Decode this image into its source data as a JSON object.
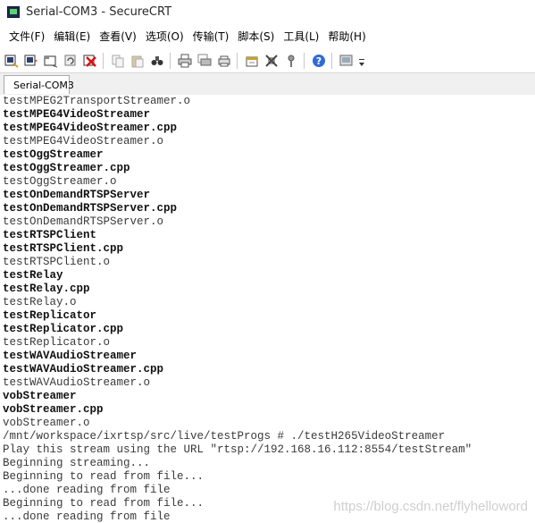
{
  "window": {
    "title": "Serial-COM3 - SecureCRT"
  },
  "menu": [
    "文件(F)",
    "编辑(E)",
    "查看(V)",
    "选项(O)",
    "传输(T)",
    "脚本(S)",
    "工具(L)",
    "帮助(H)"
  ],
  "toolbar_icons": [
    "connect-icon",
    "quick-connect-icon",
    "connect-tab-icon",
    "reconnect-icon",
    "disconnect-icon",
    "copy-icon",
    "paste-icon",
    "find-icon",
    "print-icon",
    "print-selection-icon",
    "printer-setup-icon",
    "session-options-icon",
    "global-options-icon",
    "keymap-icon",
    "help-icon",
    "sftp-icon",
    "more-icon"
  ],
  "tab": {
    "label": "Serial-COM3",
    "status_color": "#33c233"
  },
  "terminal_lines": [
    {
      "text": "testMPEG2TransportStreamer.o",
      "bold": false
    },
    {
      "text": "testMPEG4VideoStreamer",
      "bold": true
    },
    {
      "text": "testMPEG4VideoStreamer.cpp",
      "bold": true
    },
    {
      "text": "testMPEG4VideoStreamer.o",
      "bold": false
    },
    {
      "text": "testOggStreamer",
      "bold": true
    },
    {
      "text": "testOggStreamer.cpp",
      "bold": true
    },
    {
      "text": "testOggStreamer.o",
      "bold": false
    },
    {
      "text": "testOnDemandRTSPServer",
      "bold": true
    },
    {
      "text": "testOnDemandRTSPServer.cpp",
      "bold": true
    },
    {
      "text": "testOnDemandRTSPServer.o",
      "bold": false
    },
    {
      "text": "testRTSPClient",
      "bold": true
    },
    {
      "text": "testRTSPClient.cpp",
      "bold": true
    },
    {
      "text": "testRTSPClient.o",
      "bold": false
    },
    {
      "text": "testRelay",
      "bold": true
    },
    {
      "text": "testRelay.cpp",
      "bold": true
    },
    {
      "text": "testRelay.o",
      "bold": false
    },
    {
      "text": "testReplicator",
      "bold": true
    },
    {
      "text": "testReplicator.cpp",
      "bold": true
    },
    {
      "text": "testReplicator.o",
      "bold": false
    },
    {
      "text": "testWAVAudioStreamer",
      "bold": true
    },
    {
      "text": "testWAVAudioStreamer.cpp",
      "bold": true
    },
    {
      "text": "testWAVAudioStreamer.o",
      "bold": false
    },
    {
      "text": "vobStreamer",
      "bold": true
    },
    {
      "text": "vobStreamer.cpp",
      "bold": true
    },
    {
      "text": "vobStreamer.o",
      "bold": false
    },
    {
      "text": "/mnt/workspace/ixrtsp/src/live/testProgs # ./testH265VideoStreamer",
      "bold": false
    },
    {
      "text": "Play this stream using the URL \"rtsp://192.168.16.112:8554/testStream\"",
      "bold": false
    },
    {
      "text": "Beginning streaming...",
      "bold": false
    },
    {
      "text": "Beginning to read from file...",
      "bold": false
    },
    {
      "text": "...done reading from file",
      "bold": false
    },
    {
      "text": "Beginning to read from file...",
      "bold": false
    },
    {
      "text": "...done reading from file",
      "bold": false
    }
  ],
  "watermark": "https://blog.csdn.net/flyhelloword"
}
